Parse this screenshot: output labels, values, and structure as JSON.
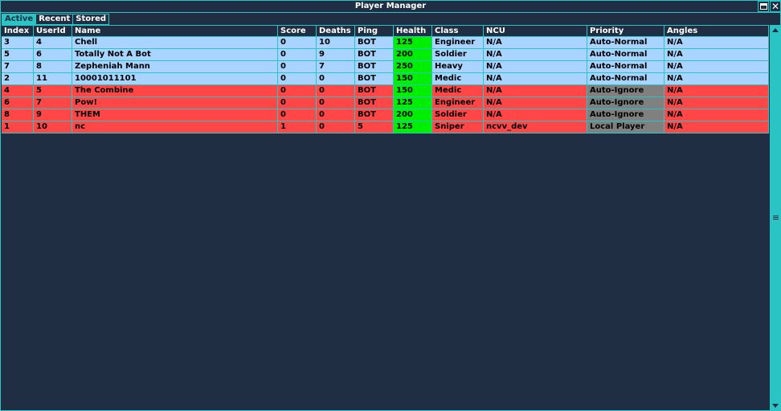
{
  "window": {
    "title": "Player Manager"
  },
  "tabs": [
    "Active",
    "Recent",
    "Stored"
  ],
  "columns": [
    "Index",
    "UserId",
    "Name",
    "Score",
    "Deaths",
    "Ping",
    "Health",
    "Class",
    "NCU",
    "Priority",
    "Angles"
  ],
  "rows": [
    {
      "status": "blue",
      "index": "3",
      "userid": "4",
      "name": "Chell",
      "score": "0",
      "deaths": "10",
      "ping": "BOT",
      "health": "125",
      "class": "Engineer",
      "ncu": "N/A",
      "priority": "Auto-Normal",
      "angles": "N/A"
    },
    {
      "status": "blue",
      "index": "5",
      "userid": "6",
      "name": "Totally Not A Bot",
      "score": "0",
      "deaths": "9",
      "ping": "BOT",
      "health": "200",
      "class": "Soldier",
      "ncu": "N/A",
      "priority": "Auto-Normal",
      "angles": "N/A"
    },
    {
      "status": "blue",
      "index": "7",
      "userid": "8",
      "name": "Zepheniah Mann",
      "score": "0",
      "deaths": "7",
      "ping": "BOT",
      "health": "250",
      "class": "Heavy",
      "ncu": "N/A",
      "priority": "Auto-Normal",
      "angles": "N/A"
    },
    {
      "status": "blue",
      "index": "2",
      "userid": "11",
      "name": "10001011101",
      "score": "0",
      "deaths": "0",
      "ping": "BOT",
      "health": "150",
      "class": "Medic",
      "ncu": "N/A",
      "priority": "Auto-Normal",
      "angles": "N/A"
    },
    {
      "status": "red",
      "index": "4",
      "userid": "5",
      "name": "The Combine",
      "score": "0",
      "deaths": "0",
      "ping": "BOT",
      "health": "150",
      "class": "Medic",
      "ncu": "N/A",
      "priority": "Auto-Ignore",
      "angles": "N/A"
    },
    {
      "status": "red",
      "index": "6",
      "userid": "7",
      "name": "Pow!",
      "score": "0",
      "deaths": "0",
      "ping": "BOT",
      "health": "125",
      "class": "Engineer",
      "ncu": "N/A",
      "priority": "Auto-Ignore",
      "angles": "N/A"
    },
    {
      "status": "red",
      "index": "8",
      "userid": "9",
      "name": "THEM",
      "score": "0",
      "deaths": "0",
      "ping": "BOT",
      "health": "200",
      "class": "Soldier",
      "ncu": "N/A",
      "priority": "Auto-Ignore",
      "angles": "N/A"
    },
    {
      "status": "red",
      "index": "1",
      "userid": "10",
      "name": "nc",
      "score": "1",
      "deaths": "0",
      "ping": "5",
      "health": "125",
      "class": "Sniper",
      "ncu": "ncvv_dev",
      "priority": "Local Player",
      "angles": "N/A"
    }
  ],
  "colors": {
    "background": "#1f2e42",
    "accent": "#2bc4c4",
    "blue_team": "#a8d4ff",
    "red_team": "#ff4747",
    "health": "#00ee00",
    "priority_grey": "#808080"
  },
  "icons": {
    "maximize": "maximize-icon",
    "close": "close-icon",
    "scroll_up": "arrow-up-icon",
    "scroll_down": "arrow-down-icon"
  }
}
